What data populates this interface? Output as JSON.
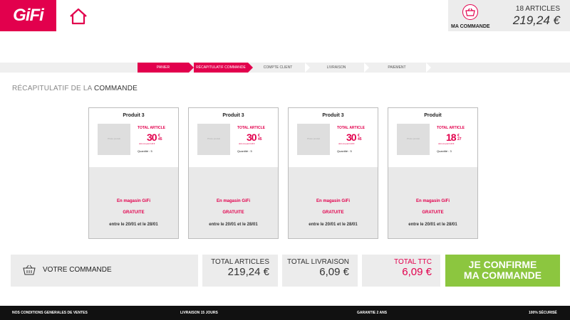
{
  "header": {
    "logo": "GiFi",
    "cart": {
      "label": "MA COMMANDE",
      "articles": "18 ARTICLES",
      "total": "219,24 €"
    }
  },
  "steps": [
    {
      "label": "PANIER",
      "active": true
    },
    {
      "label": "RÉCAPITULATIF COMMANDE",
      "active": true
    },
    {
      "label": "COMPTE CLIENT",
      "active": false
    },
    {
      "label": "LIVRAISON",
      "active": false
    },
    {
      "label": "PAIEMENT",
      "active": false
    }
  ],
  "section": {
    "title_light": "RÉCAPITULATIF DE LA",
    "title_dark": "COMMANDE"
  },
  "products": [
    {
      "name": "Produit 3",
      "image_text": "Photo produit",
      "total_label": "TOTAL ARTICLE",
      "price_int": "30",
      "price_cur": "€",
      "price_dec": "45",
      "unit": "dont éco-part 0,09 €",
      "qty": "Quantité : 5",
      "store": "En magasin GiFi",
      "free": "GRATUITE",
      "dates": "entre le  20/01  et le 28/01"
    },
    {
      "name": "Produit 3",
      "image_text": "Photo produit",
      "total_label": "TOTAL ARTICLE",
      "price_int": "30",
      "price_cur": "€",
      "price_dec": "45",
      "unit": "dont éco-part 0,09 €",
      "qty": "Quantité : 5",
      "store": "En magasin GiFi",
      "free": "GRATUITE",
      "dates": "entre le  20/01  et le 28/01"
    },
    {
      "name": "Produit 3",
      "image_text": "Photo produit",
      "total_label": "TOTAL ARTICLE",
      "price_int": "30",
      "price_cur": "€",
      "price_dec": "45",
      "unit": "dont éco-part 0,09 €",
      "qty": "Quantité : 5",
      "store": "En magasin GiFi",
      "free": "GRATUITE",
      "dates": "entre le  20/01  et le 28/01"
    },
    {
      "name": "Produit",
      "image_text": "Photo produit",
      "total_label": "TOTAL ARTICLE",
      "price_int": "18",
      "price_cur": "€",
      "price_dec": "27",
      "unit": "dont éco-part 0,09 €",
      "qty": "Quantité : 3",
      "store": "En magasin GiFi",
      "free": "GRATUITE",
      "dates": "entre le  20/01  et le 28/01"
    }
  ],
  "summary": {
    "order_label": "VOTRE COMMANDE",
    "articles_label": "TOTAL ARTICLES",
    "articles_value": "219,24 €",
    "delivery_label": "TOTAL LIVRAISON",
    "delivery_value": "6,09 €",
    "ttc_label": "TOTAL TTC",
    "ttc_value": "6,09 €",
    "confirm_line1": "JE CONFIRME",
    "confirm_line2": "MA COMMANDE"
  },
  "footer": {
    "conditions": "NOS CONDITIONS GENERALES DE VENTES",
    "delivery": "LIVRAISON 15 JOURS",
    "warranty": "GARANTIE 2 ANS",
    "secure": "100% SÉCURISÉ"
  },
  "colors": {
    "brand": "#e2004d",
    "confirm": "#8cc63f"
  },
  "icons": {
    "home": "home-icon",
    "basket": "basket-icon"
  }
}
